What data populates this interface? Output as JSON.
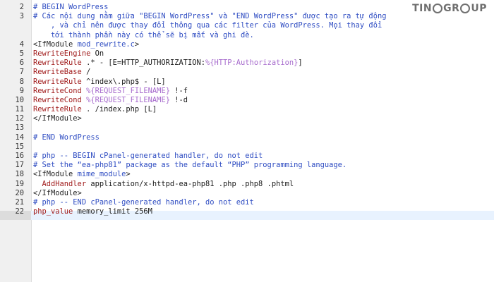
{
  "logo": {
    "text_left": "TIN",
    "text_mid": "GR",
    "text_right": "UP"
  },
  "lines": [
    {
      "num": "2",
      "segments": [
        {
          "t": "cm",
          "v": "# BEGIN WordPress"
        }
      ]
    },
    {
      "num": "3",
      "segments": [
        {
          "t": "cm",
          "v": "# Các nội dung nằm giữa \"BEGIN WordPress\" và \"END WordPress\" được tạo ra tự động"
        }
      ]
    },
    {
      "num": "",
      "segments": [
        {
          "t": "cm",
          "v": "    , và chỉ nên được thay đổi thông qua các filter của WordPress. Mọi thay đổi"
        }
      ]
    },
    {
      "num": "",
      "segments": [
        {
          "t": "cm",
          "v": "    tới thành phần này có thể sẽ bị mất và ghi đè."
        }
      ]
    },
    {
      "num": "4",
      "segments": [
        {
          "t": "tag",
          "v": "<IfModule "
        },
        {
          "t": "cm",
          "v": "mod_rewrite.c"
        },
        {
          "t": "tag",
          "v": ">"
        }
      ]
    },
    {
      "num": "5",
      "segments": [
        {
          "t": "dir",
          "v": "RewriteEngine"
        },
        {
          "t": "plain",
          "v": " On"
        }
      ]
    },
    {
      "num": "6",
      "segments": [
        {
          "t": "dir",
          "v": "RewriteRule"
        },
        {
          "t": "plain",
          "v": " .* - [E=HTTP_AUTHORIZATION:"
        },
        {
          "t": "var",
          "v": "%{HTTP:Authorization}"
        },
        {
          "t": "plain",
          "v": "]"
        }
      ]
    },
    {
      "num": "7",
      "segments": [
        {
          "t": "dir",
          "v": "RewriteBase"
        },
        {
          "t": "plain",
          "v": " /"
        }
      ]
    },
    {
      "num": "8",
      "segments": [
        {
          "t": "dir",
          "v": "RewriteRule"
        },
        {
          "t": "plain",
          "v": " ^index\\.php$ - [L]"
        }
      ]
    },
    {
      "num": "9",
      "segments": [
        {
          "t": "dir",
          "v": "RewriteCond"
        },
        {
          "t": "plain",
          "v": " "
        },
        {
          "t": "var",
          "v": "%{REQUEST_FILENAME}"
        },
        {
          "t": "plain",
          "v": " !-f"
        }
      ]
    },
    {
      "num": "10",
      "segments": [
        {
          "t": "dir",
          "v": "RewriteCond"
        },
        {
          "t": "plain",
          "v": " "
        },
        {
          "t": "var",
          "v": "%{REQUEST_FILENAME}"
        },
        {
          "t": "plain",
          "v": " !-d"
        }
      ]
    },
    {
      "num": "11",
      "segments": [
        {
          "t": "dir",
          "v": "RewriteRule"
        },
        {
          "t": "plain",
          "v": " . /index.php [L]"
        }
      ]
    },
    {
      "num": "12",
      "segments": [
        {
          "t": "tag",
          "v": "</IfModule>"
        }
      ]
    },
    {
      "num": "13",
      "segments": []
    },
    {
      "num": "14",
      "segments": [
        {
          "t": "cm",
          "v": "# END WordPress"
        }
      ]
    },
    {
      "num": "15",
      "segments": []
    },
    {
      "num": "16",
      "segments": [
        {
          "t": "cm",
          "v": "# php -- BEGIN cPanel-generated handler, do not edit"
        }
      ]
    },
    {
      "num": "17",
      "segments": [
        {
          "t": "cm",
          "v": "# Set the “ea-php81” package as the default “PHP” programming language."
        }
      ]
    },
    {
      "num": "18",
      "segments": [
        {
          "t": "tag",
          "v": "<IfModule "
        },
        {
          "t": "cm",
          "v": "mime_module"
        },
        {
          "t": "tag",
          "v": ">"
        }
      ]
    },
    {
      "num": "19",
      "segments": [
        {
          "t": "plain",
          "v": "  "
        },
        {
          "t": "dir",
          "v": "AddHandler"
        },
        {
          "t": "plain",
          "v": " application/x-httpd-ea-php81 .php .php8 .phtml"
        }
      ]
    },
    {
      "num": "20",
      "segments": [
        {
          "t": "tag",
          "v": "</IfModule>"
        }
      ]
    },
    {
      "num": "21",
      "segments": [
        {
          "t": "cm",
          "v": "# php -- END cPanel-generated handler, do not edit"
        }
      ]
    },
    {
      "num": "22",
      "segments": [
        {
          "t": "dir",
          "v": "php_value"
        },
        {
          "t": "plain",
          "v": " memory_limit 256M"
        }
      ]
    }
  ]
}
